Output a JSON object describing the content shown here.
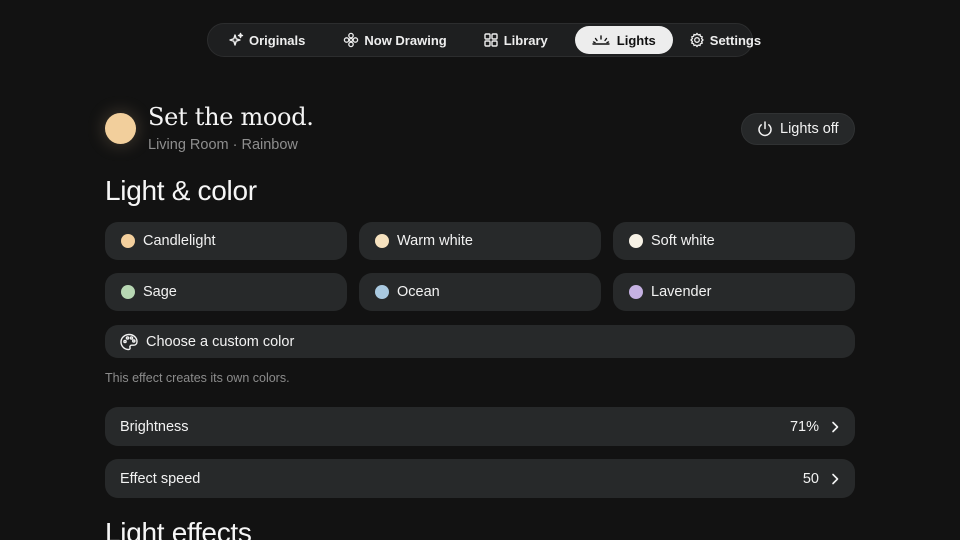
{
  "nav": {
    "items": [
      {
        "label": "Originals",
        "icon": "sparkles-icon"
      },
      {
        "label": "Now Drawing",
        "icon": "flower-icon"
      },
      {
        "label": "Library",
        "icon": "grid-icon"
      },
      {
        "label": "Lights",
        "icon": "sunrise-icon",
        "active": true
      },
      {
        "label": "Settings",
        "icon": "gear-icon"
      }
    ]
  },
  "header": {
    "title": "Set the mood.",
    "subtitle": "Living Room · Rainbow",
    "mood_color": "#f2cf9c",
    "lights_off_label": "Lights off"
  },
  "light_color": {
    "title": "Light & color",
    "presets": [
      {
        "label": "Candlelight",
        "color": "#f3cf9d"
      },
      {
        "label": "Warm white",
        "color": "#f6e2bf"
      },
      {
        "label": "Soft white",
        "color": "#f7f2e6"
      },
      {
        "label": "Sage",
        "color": "#b7d7b3"
      },
      {
        "label": "Ocean",
        "color": "#a9c9e0"
      },
      {
        "label": "Lavender",
        "color": "#c5b1e2"
      }
    ],
    "custom_label": "Choose a custom color",
    "hint": "This effect creates its own colors."
  },
  "controls": [
    {
      "label": "Brightness",
      "value": "71%"
    },
    {
      "label": "Effect speed",
      "value": "50"
    }
  ],
  "effects": {
    "title": "Light effects"
  }
}
